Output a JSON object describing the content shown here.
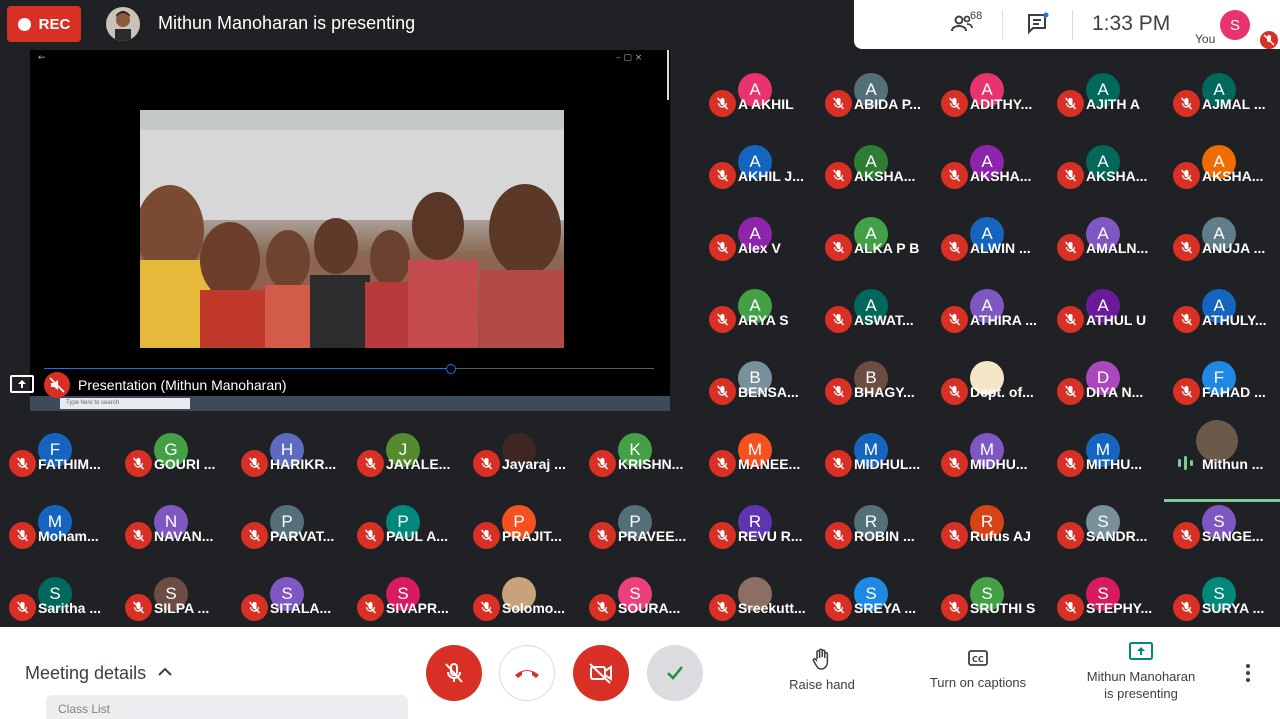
{
  "recording": {
    "label": "REC"
  },
  "presenter_banner": "Mithun Manoharan is presenting",
  "topbar": {
    "participant_count": "68",
    "time": "1:33 PM",
    "you_initial": "S",
    "you_label": "You"
  },
  "presentation": {
    "label": "Presentation (Mithun Manoharan)",
    "search_placeholder": "Type here to search"
  },
  "participants": [
    {
      "initial": "A",
      "name": "A AKHIL",
      "color": "#e8336d"
    },
    {
      "initial": "A",
      "name": "ABIDA P...",
      "color": "#546e7a"
    },
    {
      "initial": "A",
      "name": "ADITHY...",
      "color": "#e8336d"
    },
    {
      "initial": "A",
      "name": "AJITH A",
      "color": "#00695c"
    },
    {
      "initial": "A",
      "name": "AJMAL ...",
      "color": "#00695c"
    },
    {
      "initial": "A",
      "name": "AKHIL J...",
      "color": "#1565c0"
    },
    {
      "initial": "A",
      "name": "AKSHA...",
      "color": "#2e7d32"
    },
    {
      "initial": "A",
      "name": "AKSHA...",
      "color": "#8e24aa"
    },
    {
      "initial": "A",
      "name": "AKSHA...",
      "color": "#00695c"
    },
    {
      "initial": "A",
      "name": "AKSHA...",
      "color": "#ef6c00"
    },
    {
      "initial": "A",
      "name": "Alex V",
      "color": "#8e24aa"
    },
    {
      "initial": "A",
      "name": "ALKA P B",
      "color": "#43a047"
    },
    {
      "initial": "A",
      "name": "ALWIN ...",
      "color": "#1565c0"
    },
    {
      "initial": "A",
      "name": "AMALN...",
      "color": "#7e57c2"
    },
    {
      "initial": "A",
      "name": "ANUJA ...",
      "color": "#607d8b"
    },
    {
      "initial": "A",
      "name": "ARYA S",
      "color": "#43a047"
    },
    {
      "initial": "A",
      "name": "ASWAT...",
      "color": "#00695c"
    },
    {
      "initial": "A",
      "name": "ATHIRA ...",
      "color": "#7e57c2"
    },
    {
      "initial": "A",
      "name": "ATHUL U",
      "color": "#6a1b9a"
    },
    {
      "initial": "A",
      "name": "ATHULY...",
      "color": "#1565c0"
    },
    {
      "initial": "B",
      "name": "BENSA...",
      "color": "#78909c"
    },
    {
      "initial": "B",
      "name": "BHAGY...",
      "color": "#6d4c41"
    },
    {
      "initial": "",
      "name": "Dept. of...",
      "color": "#f5e6c8"
    },
    {
      "initial": "D",
      "name": "DIYA N...",
      "color": "#ab47bc"
    },
    {
      "initial": "F",
      "name": "FAHAD ...",
      "color": "#1e88e5"
    },
    {
      "initial": "F",
      "name": "FATHIM...",
      "color": "#1565c0"
    },
    {
      "initial": "G",
      "name": "GOURI ...",
      "color": "#43a047"
    },
    {
      "initial": "H",
      "name": "HARIKR...",
      "color": "#5c6bc0"
    },
    {
      "initial": "J",
      "name": "JAYALE...",
      "color": "#558b2f"
    },
    {
      "initial": "",
      "name": "Jayaraj ...",
      "color": "#3e2723"
    },
    {
      "initial": "K",
      "name": "KRISHN...",
      "color": "#43a047"
    },
    {
      "initial": "M",
      "name": "MANEE...",
      "color": "#f4511e"
    },
    {
      "initial": "M",
      "name": "MIDHUL...",
      "color": "#1565c0"
    },
    {
      "initial": "M",
      "name": "MIDHU...",
      "color": "#7e57c2"
    },
    {
      "initial": "M",
      "name": "MITHU...",
      "color": "#1565c0"
    },
    {
      "initial": "",
      "name": "Mithun ...",
      "color": "#6b5a4a"
    },
    {
      "initial": "M",
      "name": "Moham...",
      "color": "#1565c0"
    },
    {
      "initial": "N",
      "name": "NAVAN...",
      "color": "#7e57c2"
    },
    {
      "initial": "P",
      "name": "PARVAT...",
      "color": "#546e7a"
    },
    {
      "initial": "P",
      "name": "PAUL A...",
      "color": "#00897b"
    },
    {
      "initial": "P",
      "name": "PRAJIT...",
      "color": "#f4511e"
    },
    {
      "initial": "P",
      "name": "PRAVEE...",
      "color": "#546e7a"
    },
    {
      "initial": "R",
      "name": "REVU R...",
      "color": "#5e35b1"
    },
    {
      "initial": "R",
      "name": "ROBIN ...",
      "color": "#546e7a"
    },
    {
      "initial": "R",
      "name": "Rufus AJ",
      "color": "#d84315"
    },
    {
      "initial": "S",
      "name": "SANDR...",
      "color": "#78909c"
    },
    {
      "initial": "S",
      "name": "SANGE...",
      "color": "#7e57c2"
    },
    {
      "initial": "S",
      "name": "Saritha ...",
      "color": "#00695c"
    },
    {
      "initial": "S",
      "name": "SILPA ...",
      "color": "#6d4c41"
    },
    {
      "initial": "S",
      "name": "SITALA...",
      "color": "#7e57c2"
    },
    {
      "initial": "S",
      "name": "SIVAPR...",
      "color": "#d81b60"
    },
    {
      "initial": "",
      "name": "Solomo...",
      "color": "#c8a27a"
    },
    {
      "initial": "S",
      "name": "SOURA...",
      "color": "#ec407a"
    },
    {
      "initial": "",
      "name": "Sreekutt...",
      "color": "#8d6e63"
    },
    {
      "initial": "S",
      "name": "SREYA ...",
      "color": "#1e88e5"
    },
    {
      "initial": "S",
      "name": "SRUTHI S",
      "color": "#43a047"
    },
    {
      "initial": "S",
      "name": "STEPHY...",
      "color": "#d81b60"
    },
    {
      "initial": "S",
      "name": "SURYA ...",
      "color": "#00897b"
    }
  ],
  "bottombar": {
    "meeting_details": "Meeting details",
    "class_list": "Class List",
    "raise_hand": "Raise hand",
    "captions": "Turn on captions",
    "presenting_line1": "Mithun Manoharan",
    "presenting_line2": "is presenting"
  },
  "colors": {
    "accent_red": "#d93025",
    "speaking": "#81c995"
  }
}
